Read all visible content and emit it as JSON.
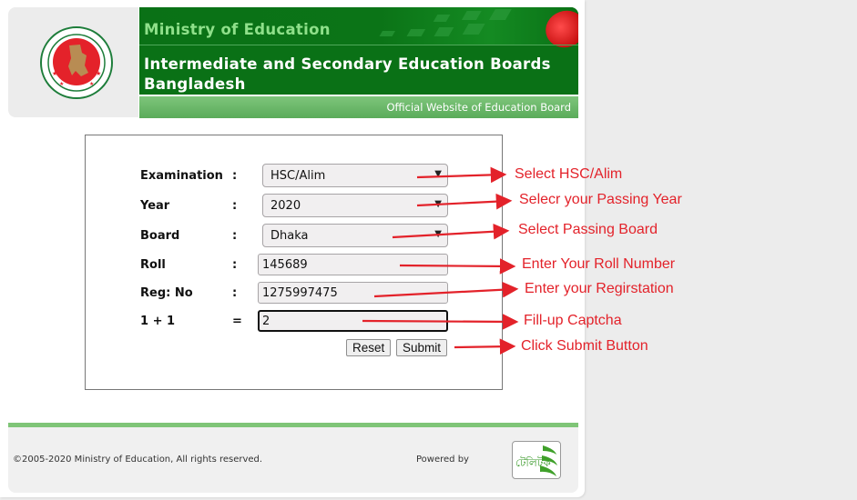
{
  "header": {
    "ministry": "Ministry of Education",
    "title_line1": "Intermediate and Secondary Education Boards",
    "title_line2": "Bangladesh",
    "subtitle": "Official Website of Education Board"
  },
  "form": {
    "fields": [
      {
        "label": "Examination",
        "sep": ":",
        "type": "select",
        "value": "HSC/Alim"
      },
      {
        "label": "Year",
        "sep": ":",
        "type": "select",
        "value": "2020"
      },
      {
        "label": "Board",
        "sep": ":",
        "type": "select",
        "value": "Dhaka"
      },
      {
        "label": "Roll",
        "sep": ":",
        "type": "input",
        "value": "145689"
      },
      {
        "label": "Reg: No",
        "sep": ":",
        "type": "input",
        "value": "1275997475"
      },
      {
        "label": "1 + 1",
        "sep": "=",
        "type": "input",
        "value": "2"
      }
    ],
    "reset_label": "Reset",
    "submit_label": "Submit"
  },
  "annotations": [
    "Select HSC/Alim",
    "Selecr your Passing Year",
    "Select Passing Board",
    "Enter Your Roll Number",
    "Enter your Regirstation",
    "Fill-up Captcha",
    "Click Submit Button"
  ],
  "footer": {
    "copyright": "©2005-2020 Ministry of Education, All rights reserved.",
    "powered_by": "Powered by",
    "teletalk_text": "টেলিটক"
  },
  "colors": {
    "brand_green": "#0a7116",
    "annotation_red": "#e3222a",
    "footer_line": "#7fc577"
  }
}
